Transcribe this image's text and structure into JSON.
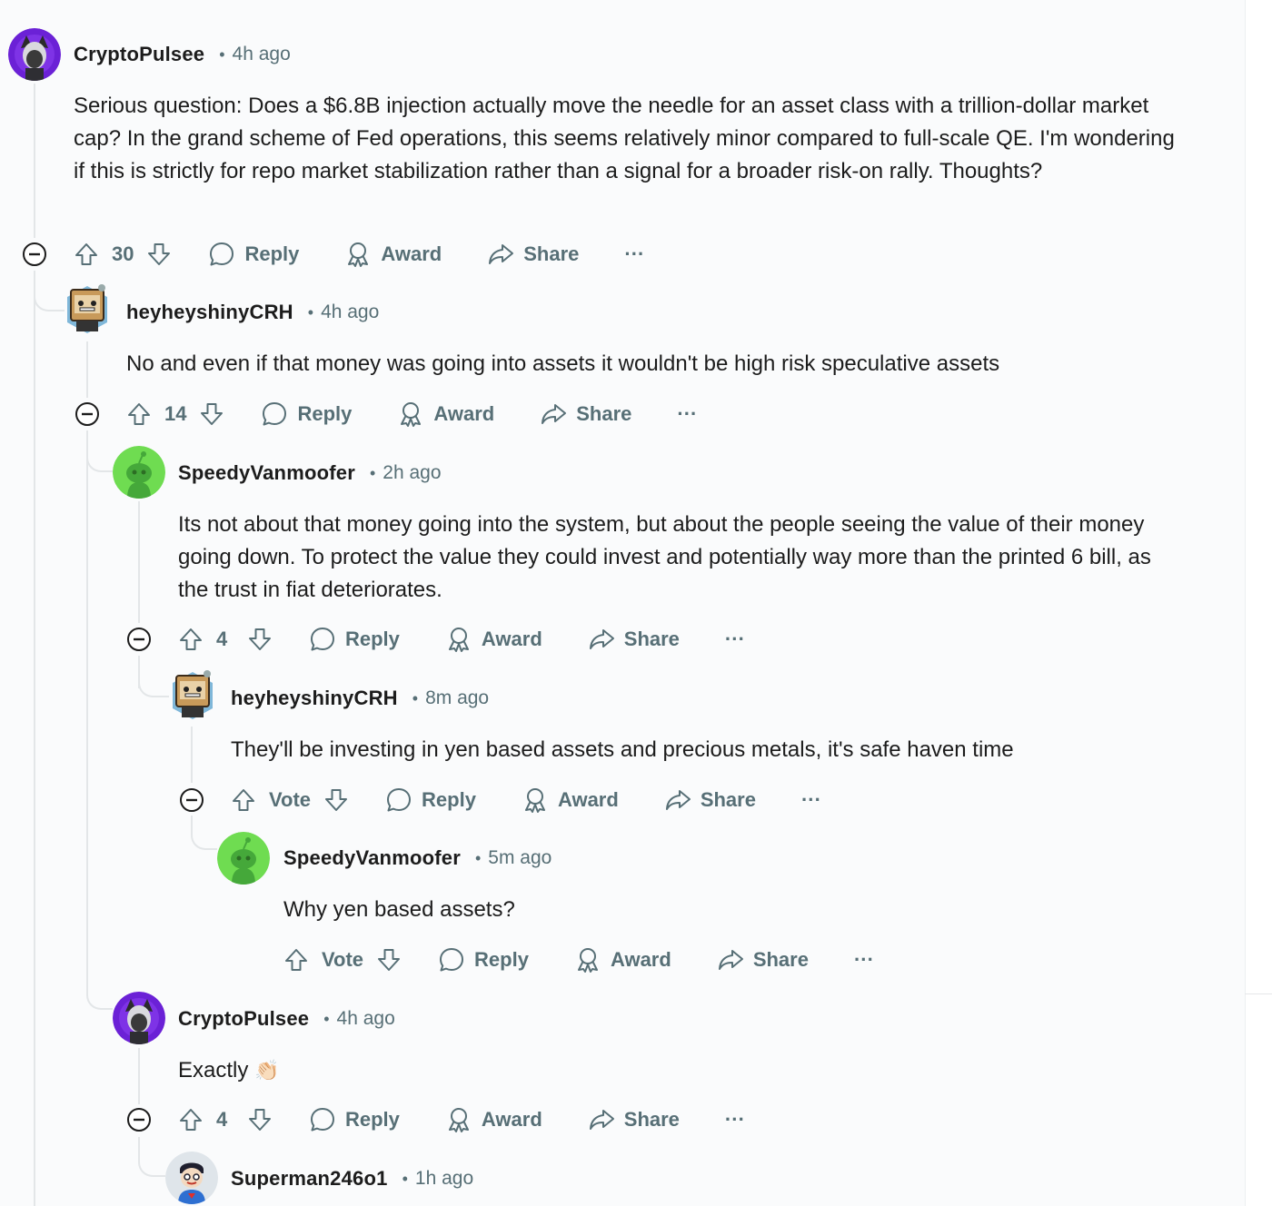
{
  "comments": [
    {
      "username": "CryptoPulsee",
      "separator": "•",
      "time": "4h ago",
      "body": "Serious question: Does a $6.8B injection actually move the needle for an asset class with a trillion-dollar market cap? In the grand scheme of Fed operations, this seems relatively minor compared to full-scale QE. I'm wondering if this is strictly for repo market stabilization rather than a signal for a broader risk-on rally. Thoughts?",
      "score": "30"
    },
    {
      "username": "heyheyshinyCRH",
      "separator": "•",
      "time": "4h ago",
      "body": "No and even if that money was going into assets it wouldn't be high risk speculative assets",
      "score": "14"
    },
    {
      "username": "SpeedyVanmoofer",
      "separator": "•",
      "time": "2h ago",
      "body": "Its not about that money going into the system, but about the people seeing the value of their money going down. To protect the value they could invest and potentially way more than the printed 6 bill, as the trust in fiat deteriorates.",
      "score": "4"
    },
    {
      "username": "heyheyshinyCRH",
      "separator": "•",
      "time": "8m ago",
      "body": "They'll be investing in yen based assets and precious metals, it's safe haven time",
      "score": "Vote"
    },
    {
      "username": "SpeedyVanmoofer",
      "separator": "•",
      "time": "5m ago",
      "body": "Why yen based assets?",
      "score": "Vote"
    },
    {
      "username": "CryptoPulsee",
      "separator": "•",
      "time": "4h ago",
      "body": "Exactly",
      "emoji": "👏🏻",
      "score": "4"
    },
    {
      "username": "Superman246o1",
      "separator": "•",
      "time": "1h ago"
    }
  ],
  "actions": {
    "reply": "Reply",
    "award": "Award",
    "share": "Share",
    "more": "···"
  },
  "icons": {
    "upvote": "upvote-arrow-icon",
    "downvote": "downvote-arrow-icon",
    "reply": "speech-bubble-icon",
    "award": "award-ribbon-icon",
    "share": "share-arrow-icon",
    "collapse": "collapse-minus-icon"
  },
  "colors": {
    "text": "#1c1c1c",
    "meta": "#576f76",
    "thread_line": "#e3e6e8",
    "snoo_green": "#6fdc51",
    "crypto_purple": "#6b21d6"
  }
}
